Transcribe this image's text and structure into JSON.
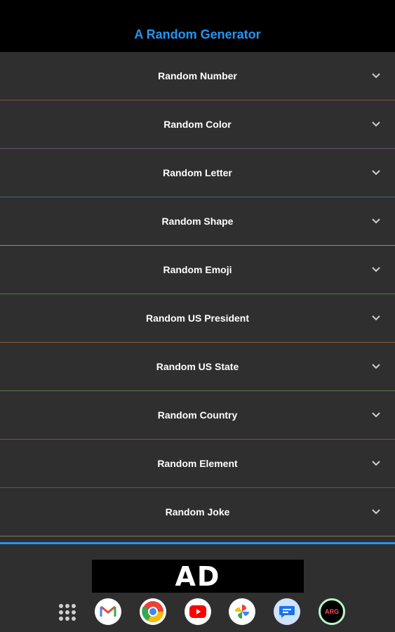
{
  "app": {
    "title": "A Random Generator"
  },
  "accordion": {
    "items": [
      {
        "label": "Random Number",
        "divider_color": "#8a4a48"
      },
      {
        "label": "Random Color",
        "divider_color": "#6d4a7a"
      },
      {
        "label": "Random Letter",
        "divider_color": "#3f6b8a"
      },
      {
        "label": "Random Shape",
        "divider_color": "#8a8a8a"
      },
      {
        "label": "Random Emoji",
        "divider_color": "#4f7a4f"
      },
      {
        "label": "Random US President",
        "divider_color": "#8a5a3a"
      },
      {
        "label": "Random US State",
        "divider_color": "#5d7a4a"
      },
      {
        "label": "Random Country",
        "divider_color": "#8a4a48"
      },
      {
        "label": "Random Element",
        "divider_color": "#7a4a48"
      },
      {
        "label": "Random Joke",
        "divider_color": "#8a7a4a"
      }
    ]
  },
  "ad": {
    "label": "AD"
  },
  "dock": {
    "icons": [
      "apps-grid-icon",
      "gmail-icon",
      "chrome-icon",
      "youtube-icon",
      "photos-icon",
      "messages-icon",
      "arg-app-icon"
    ],
    "arg_label": "ARG"
  },
  "colors": {
    "accent": "#2196f3",
    "header_bg": "#000000",
    "list_bg": "#2f2f2f"
  }
}
